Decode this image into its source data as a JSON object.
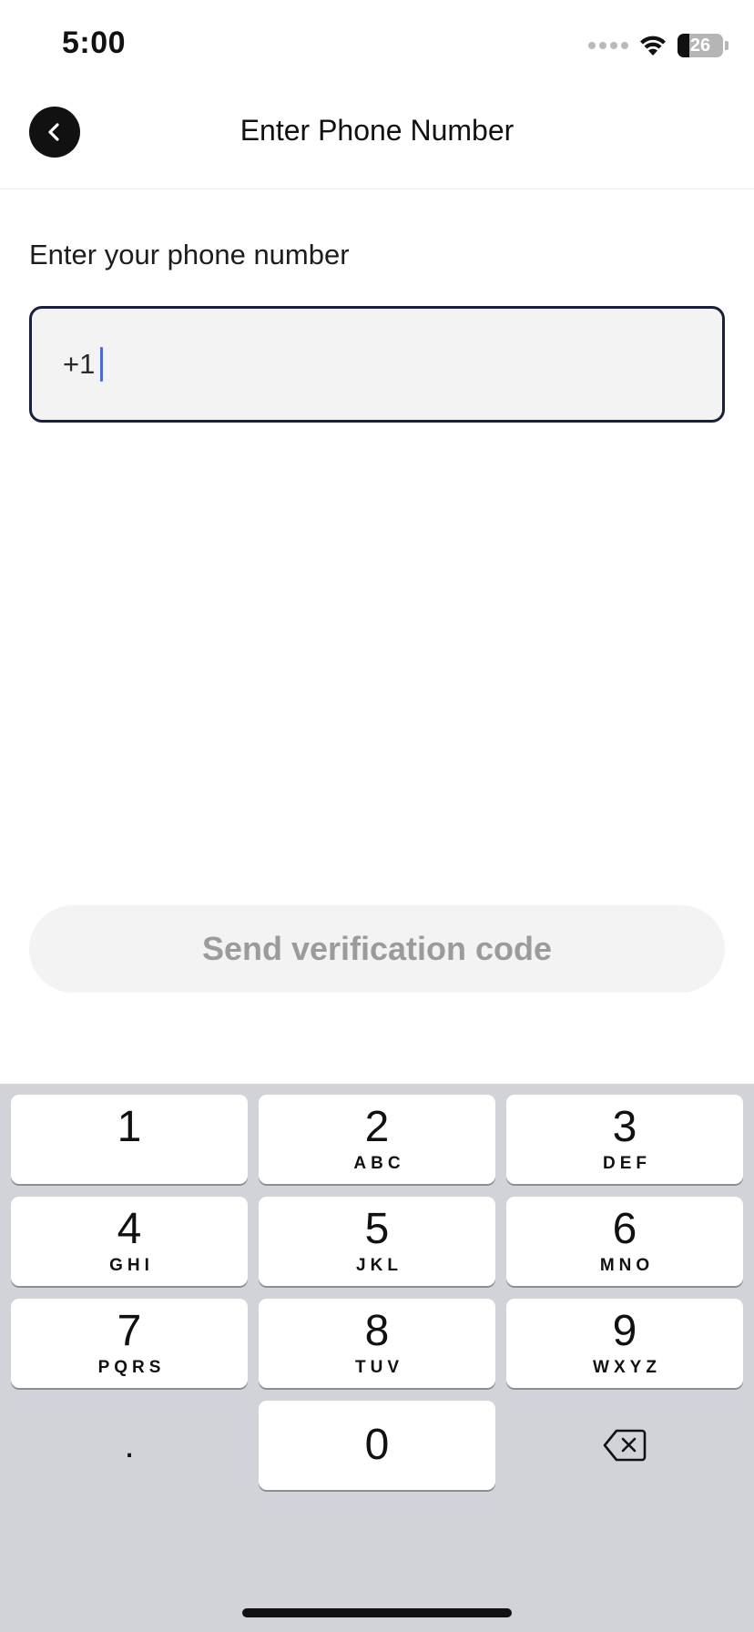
{
  "status_bar": {
    "time": "5:00",
    "battery_level": "26"
  },
  "nav": {
    "title": "Enter Phone Number"
  },
  "form": {
    "prompt": "Enter your phone number",
    "phone_value": "+1",
    "send_label": "Send verification code"
  },
  "keyboard": {
    "keys": [
      {
        "digit": "1",
        "letters": ""
      },
      {
        "digit": "2",
        "letters": "ABC"
      },
      {
        "digit": "3",
        "letters": "DEF"
      },
      {
        "digit": "4",
        "letters": "GHI"
      },
      {
        "digit": "5",
        "letters": "JKL"
      },
      {
        "digit": "6",
        "letters": "MNO"
      },
      {
        "digit": "7",
        "letters": "PQRS"
      },
      {
        "digit": "8",
        "letters": "TUV"
      },
      {
        "digit": "9",
        "letters": "WXYZ"
      },
      {
        "digit": "0",
        "letters": ""
      }
    ],
    "dot_label": "."
  },
  "colors": {
    "input_border": "#18203b",
    "caret": "#4a6bd6",
    "button_bg": "#f3f3f3",
    "button_text": "#9b9b9b",
    "keyboard_bg": "#d1d3d9"
  },
  "icons": {
    "back": "chevron-left-icon",
    "wifi": "wifi-icon",
    "battery": "battery-icon",
    "delete": "backspace-icon"
  }
}
